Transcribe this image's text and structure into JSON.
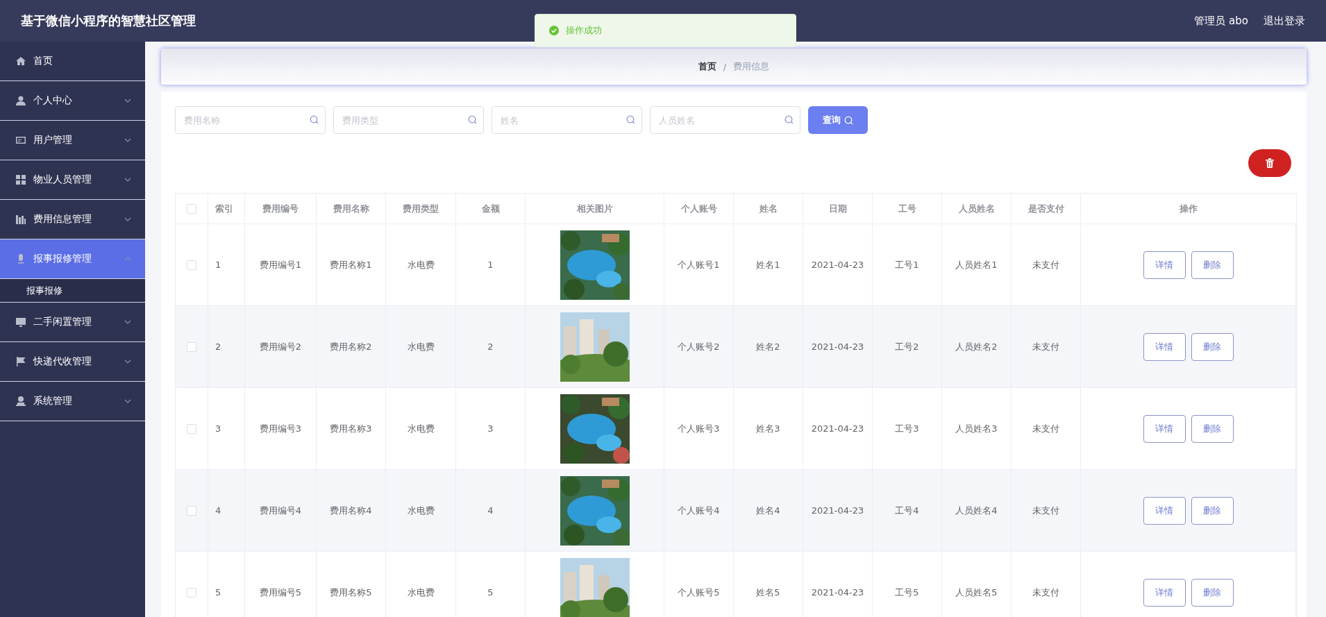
{
  "header": {
    "title": "基于微信小程序的智慧社区管理",
    "user": "管理员 abo",
    "logout": "退出登录"
  },
  "toast": {
    "message": "操作成功"
  },
  "sidebar": {
    "items": [
      {
        "label": "首页",
        "kind": "link",
        "selected": false
      },
      {
        "label": "个人中心",
        "kind": "menu",
        "selected": false,
        "expanded": false
      },
      {
        "label": "用户管理",
        "kind": "menu",
        "selected": false,
        "expanded": false
      },
      {
        "label": "物业人员管理",
        "kind": "menu",
        "selected": false,
        "expanded": false
      },
      {
        "label": "费用信息管理",
        "kind": "menu",
        "selected": false,
        "expanded": false
      },
      {
        "label": "报事报修管理",
        "kind": "menu",
        "selected": true,
        "expanded": true,
        "children": [
          {
            "label": "报事报修",
            "selected": false
          }
        ]
      },
      {
        "label": "二手闲置管理",
        "kind": "menu",
        "selected": false,
        "expanded": false
      },
      {
        "label": "快递代收管理",
        "kind": "menu",
        "selected": false,
        "expanded": false
      },
      {
        "label": "系统管理",
        "kind": "menu",
        "selected": false,
        "expanded": false
      }
    ]
  },
  "breadcrumb": {
    "separator": "/",
    "items": [
      "首页",
      "费用信息"
    ]
  },
  "search": {
    "fields": [
      {
        "placeholder": "费用名称"
      },
      {
        "placeholder": "费用类型"
      },
      {
        "placeholder": "姓名"
      },
      {
        "placeholder": "人员姓名"
      }
    ],
    "button": "查询"
  },
  "table": {
    "select_all": {
      "checked": false
    },
    "columns": [
      "索引",
      "费用编号",
      "费用名称",
      "费用类型",
      "金额",
      "相关图片",
      "个人账号",
      "姓名",
      "日期",
      "工号",
      "人员姓名",
      "是否支付",
      "操作"
    ],
    "rows": [
      {
        "checked": false,
        "cells": [
          "1",
          "费用编号1",
          "费用名称1",
          "水电费",
          "1",
          null,
          "个人账号1",
          "姓名1",
          "2021-04-23",
          "工号1",
          "人员姓名1",
          "未支付"
        ],
        "actions": [
          "详情",
          "删除"
        ]
      },
      {
        "checked": false,
        "cells": [
          "2",
          "费用编号2",
          "费用名称2",
          "水电费",
          "2",
          null,
          "个人账号2",
          "姓名2",
          "2021-04-23",
          "工号2",
          "人员姓名2",
          "未支付"
        ],
        "actions": [
          "详情",
          "删除"
        ]
      },
      {
        "checked": false,
        "cells": [
          "3",
          "费用编号3",
          "费用名称3",
          "水电费",
          "3",
          null,
          "个人账号3",
          "姓名3",
          "2021-04-23",
          "工号3",
          "人员姓名3",
          "未支付"
        ],
        "actions": [
          "详情",
          "删除"
        ]
      },
      {
        "checked": false,
        "cells": [
          "4",
          "费用编号4",
          "费用名称4",
          "水电费",
          "4",
          null,
          "个人账号4",
          "姓名4",
          "2021-04-23",
          "工号4",
          "人员姓名4",
          "未支付"
        ],
        "actions": [
          "详情",
          "删除"
        ]
      },
      {
        "checked": false,
        "cells": [
          "5",
          "费用编号5",
          "费用名称5",
          "水电费",
          "5",
          null,
          "个人账号5",
          "姓名5",
          "2021-04-23",
          "工号5",
          "人员姓名5",
          "未支付"
        ],
        "actions": [
          "详情",
          "删除"
        ]
      }
    ]
  }
}
